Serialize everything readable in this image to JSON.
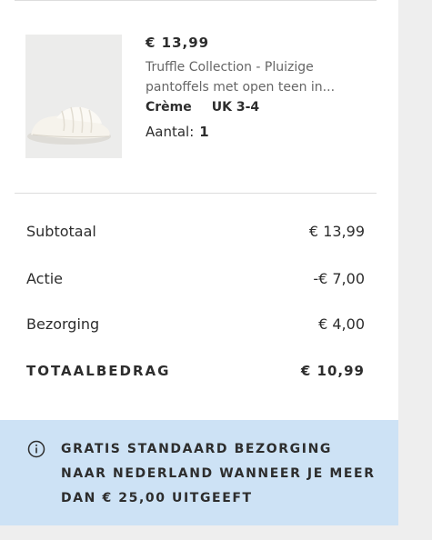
{
  "item": {
    "price": "€ 13,99",
    "name": "Truffle Collection - Pluizige pantoffels met open teen in...",
    "color": "Crème",
    "size": "UK 3-4",
    "quantity_label": "Aantal:",
    "quantity_value": "1"
  },
  "summary": {
    "subtotal_label": "Subtotaal",
    "subtotal_value": "€ 13,99",
    "discount_label": "Actie",
    "discount_value": "-€ 7,00",
    "shipping_label": "Bezorging",
    "shipping_value": "€ 4,00",
    "total_label": "TOTAALBEDRAG",
    "total_value": "€ 10,99"
  },
  "banner": {
    "icon": "info-icon",
    "text": "GRATIS STANDAARD BEZORGING NAAR NEDERLAND WANNEER JE MEER DAN € 25,00 UITGEEFT",
    "background": "#cde2f5"
  }
}
